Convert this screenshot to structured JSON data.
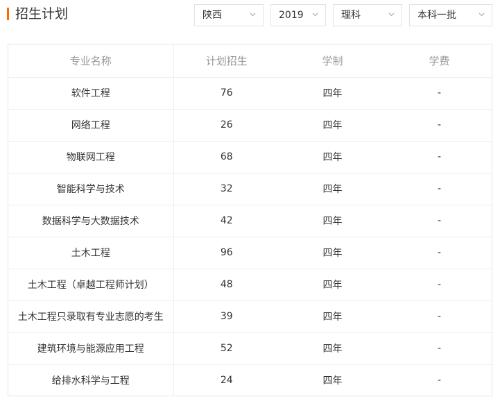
{
  "header": {
    "title": "招生计划"
  },
  "filters": [
    {
      "value": "陕西",
      "icon": "chevron-down-icon"
    },
    {
      "value": "2019",
      "icon": "chevron-down-icon"
    },
    {
      "value": "理科",
      "icon": "chevron-down-icon"
    },
    {
      "value": "本科一批",
      "icon": "chevron-down-icon"
    }
  ],
  "table": {
    "columns": [
      "专业名称",
      "计划招生",
      "学制",
      "学费"
    ],
    "rows": [
      [
        "软件工程",
        "76",
        "四年",
        "-"
      ],
      [
        "网络工程",
        "26",
        "四年",
        "-"
      ],
      [
        "物联网工程",
        "68",
        "四年",
        "-"
      ],
      [
        "智能科学与技术",
        "32",
        "四年",
        "-"
      ],
      [
        "数据科学与大数据技术",
        "42",
        "四年",
        "-"
      ],
      [
        "土木工程",
        "96",
        "四年",
        "-"
      ],
      [
        "土木工程（卓越工程师计划）",
        "48",
        "四年",
        "-"
      ],
      [
        "土木工程只录取有专业志愿的考生",
        "39",
        "四年",
        "-"
      ],
      [
        "建筑环境与能源应用工程",
        "52",
        "四年",
        "-"
      ],
      [
        "给排水科学与工程",
        "24",
        "四年",
        "-"
      ]
    ]
  },
  "colors": {
    "accent": "#ff6a00",
    "border": "#e6e6e6",
    "header_text": "#999999"
  }
}
